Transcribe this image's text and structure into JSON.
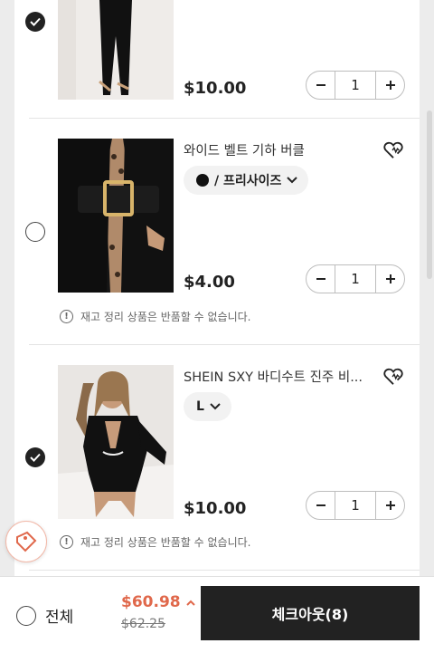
{
  "items": [
    {
      "checked": true,
      "price": "$10.00",
      "qty": "1"
    },
    {
      "checked": false,
      "title": "와이드 벨트 기하 버클",
      "variant": "/ 프리사이즈",
      "price": "$4.00",
      "qty": "1",
      "notice": "재고 정리 상품은 반품할 수 없습니다."
    },
    {
      "checked": true,
      "title": "SHEIN SXY 바디수트 진주 비...",
      "variant": "L",
      "price": "$10.00",
      "qty": "1",
      "notice": "재고 정리 상품은 반품할 수 없습니다."
    }
  ],
  "icons": {
    "check": "check-icon",
    "wishlist": "heart-icon",
    "minus": "minus-icon",
    "plus": "plus-icon",
    "chevron": "chevron-down-icon",
    "info": "info-icon",
    "expand": "chevron-up-icon",
    "coupon": "coupon-tag-icon"
  },
  "bottom_bar": {
    "select_all_label": "전체",
    "total_price": "$60.98",
    "original_price": "$62.25",
    "checkout_label": "체크아웃(8)"
  },
  "colors": {
    "accent_price": "#e0684b",
    "checkout_bg": "#222222"
  }
}
